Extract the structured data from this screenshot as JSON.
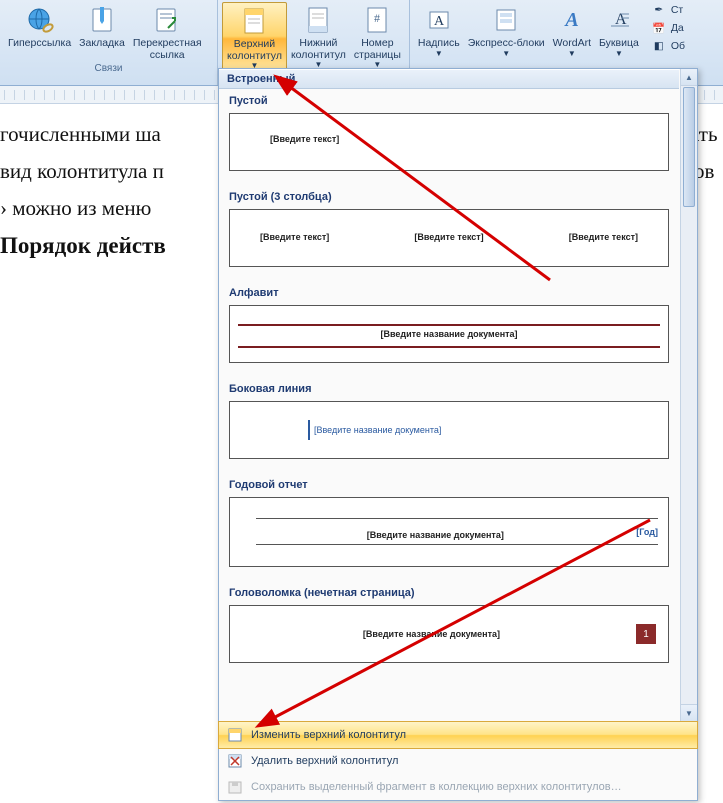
{
  "ribbon": {
    "group_links": {
      "caption": "Связи",
      "hyperlink": "Гиперссылка",
      "bookmark": "Закладка",
      "crossref": "Перекрестная\nссылка"
    },
    "group_hf": {
      "header": "Верхний\nколонтитул",
      "footer": "Нижний\nколонтитул",
      "pagenum": "Номер\nстраницы"
    },
    "group_text": {
      "textbox": "Надпись",
      "quickparts": "Экспресс-блоки",
      "wordart": "WordArt",
      "dropcap": "Буквица"
    },
    "side": {
      "signature": "Ст",
      "datetime": "Да",
      "object": "Об"
    }
  },
  "document": {
    "line1": "гочисленными ша",
    "line1_right": "ать",
    "line2": "вид колонтитула п",
    "line2_right": "ов",
    "line3": "› можно из меню",
    "heading": "Порядок действ"
  },
  "gallery": {
    "category": "Встроенный",
    "items": [
      {
        "label": "Пустой",
        "type": "single",
        "placeholder": "[Введите текст]"
      },
      {
        "label": "Пустой (3 столбца)",
        "type": "three",
        "ph1": "[Введите текст]",
        "ph2": "[Введите текст]",
        "ph3": "[Введите текст]"
      },
      {
        "label": "Алфавит",
        "type": "alphabet",
        "placeholder": "[Введите название документа]"
      },
      {
        "label": "Боковая линия",
        "type": "sideline",
        "placeholder": "[Введите название документа]"
      },
      {
        "label": "Годовой отчет",
        "type": "annual",
        "placeholder": "[Введите название документа]",
        "year": "[Год]"
      },
      {
        "label": "Головоломка (нечетная страница)",
        "type": "puzzle",
        "placeholder": "[Введите название документа]",
        "num": "1"
      }
    ],
    "footer": {
      "edit": "Изменить верхний колонтитул",
      "remove": "Удалить верхний колонтитул",
      "save": "Сохранить выделенный фрагмент в коллекцию верхних колонтитулов…"
    }
  }
}
